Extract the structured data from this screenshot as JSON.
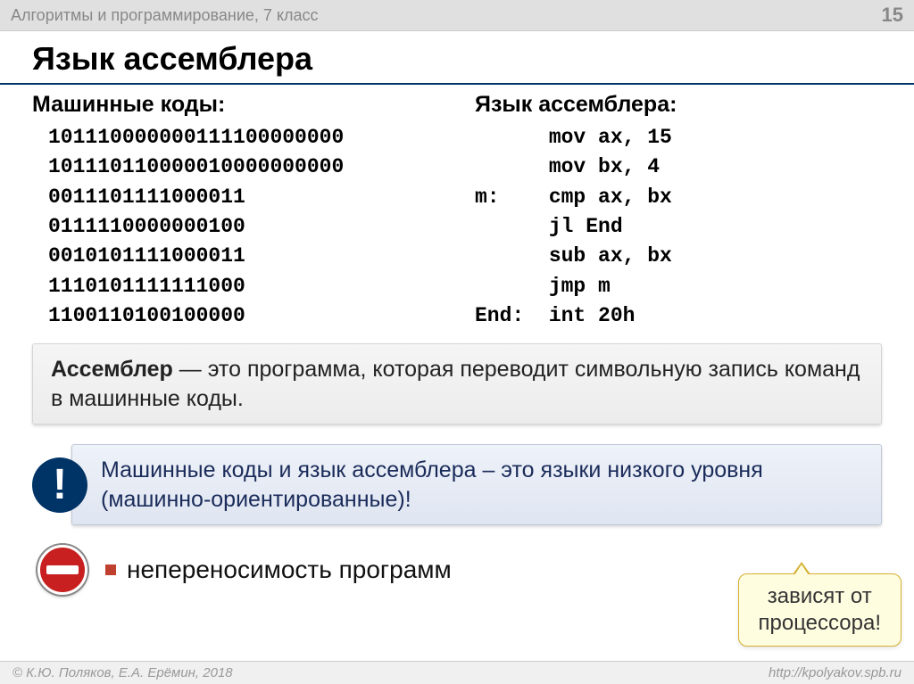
{
  "header": {
    "subject": "Алгоритмы и программирование, 7 класс",
    "page": "15"
  },
  "title": "Язык ассемблера",
  "columns": {
    "machine": {
      "header": "Машинные коды:",
      "lines": [
        "101110000000111100000000",
        "101110110000010000000000",
        "0011101111000011",
        "0111110000000100",
        "0010101111000011",
        "1110101111111000",
        "1100110100100000"
      ]
    },
    "asm": {
      "header": "Язык ассемблера:",
      "lines": [
        {
          "label": "",
          "instr": "mov ax, 15"
        },
        {
          "label": "",
          "instr": "mov bx, 4"
        },
        {
          "label": "m:",
          "instr": "cmp ax, bx"
        },
        {
          "label": "",
          "instr": "jl End"
        },
        {
          "label": "",
          "instr": "sub ax, bx"
        },
        {
          "label": "",
          "instr": "jmp m"
        },
        {
          "label": "End:",
          "instr": "int 20h"
        }
      ]
    }
  },
  "definition": {
    "term": "Ассемблер",
    "text": " — это программа, которая переводит символьную запись команд в машинные коды."
  },
  "info": {
    "badge": "!",
    "text": "Машинные коды и язык ассемблера – это языки низкого уровня (машинно-ориентированные)!"
  },
  "bullet": {
    "text": "непереносимость программ"
  },
  "callout": {
    "line1": "зависят от",
    "line2": "процессора!"
  },
  "footer": {
    "copyright": "© К.Ю. Поляков, Е.А. Ерёмин, 2018",
    "url": "http://kpolyakov.spb.ru"
  }
}
